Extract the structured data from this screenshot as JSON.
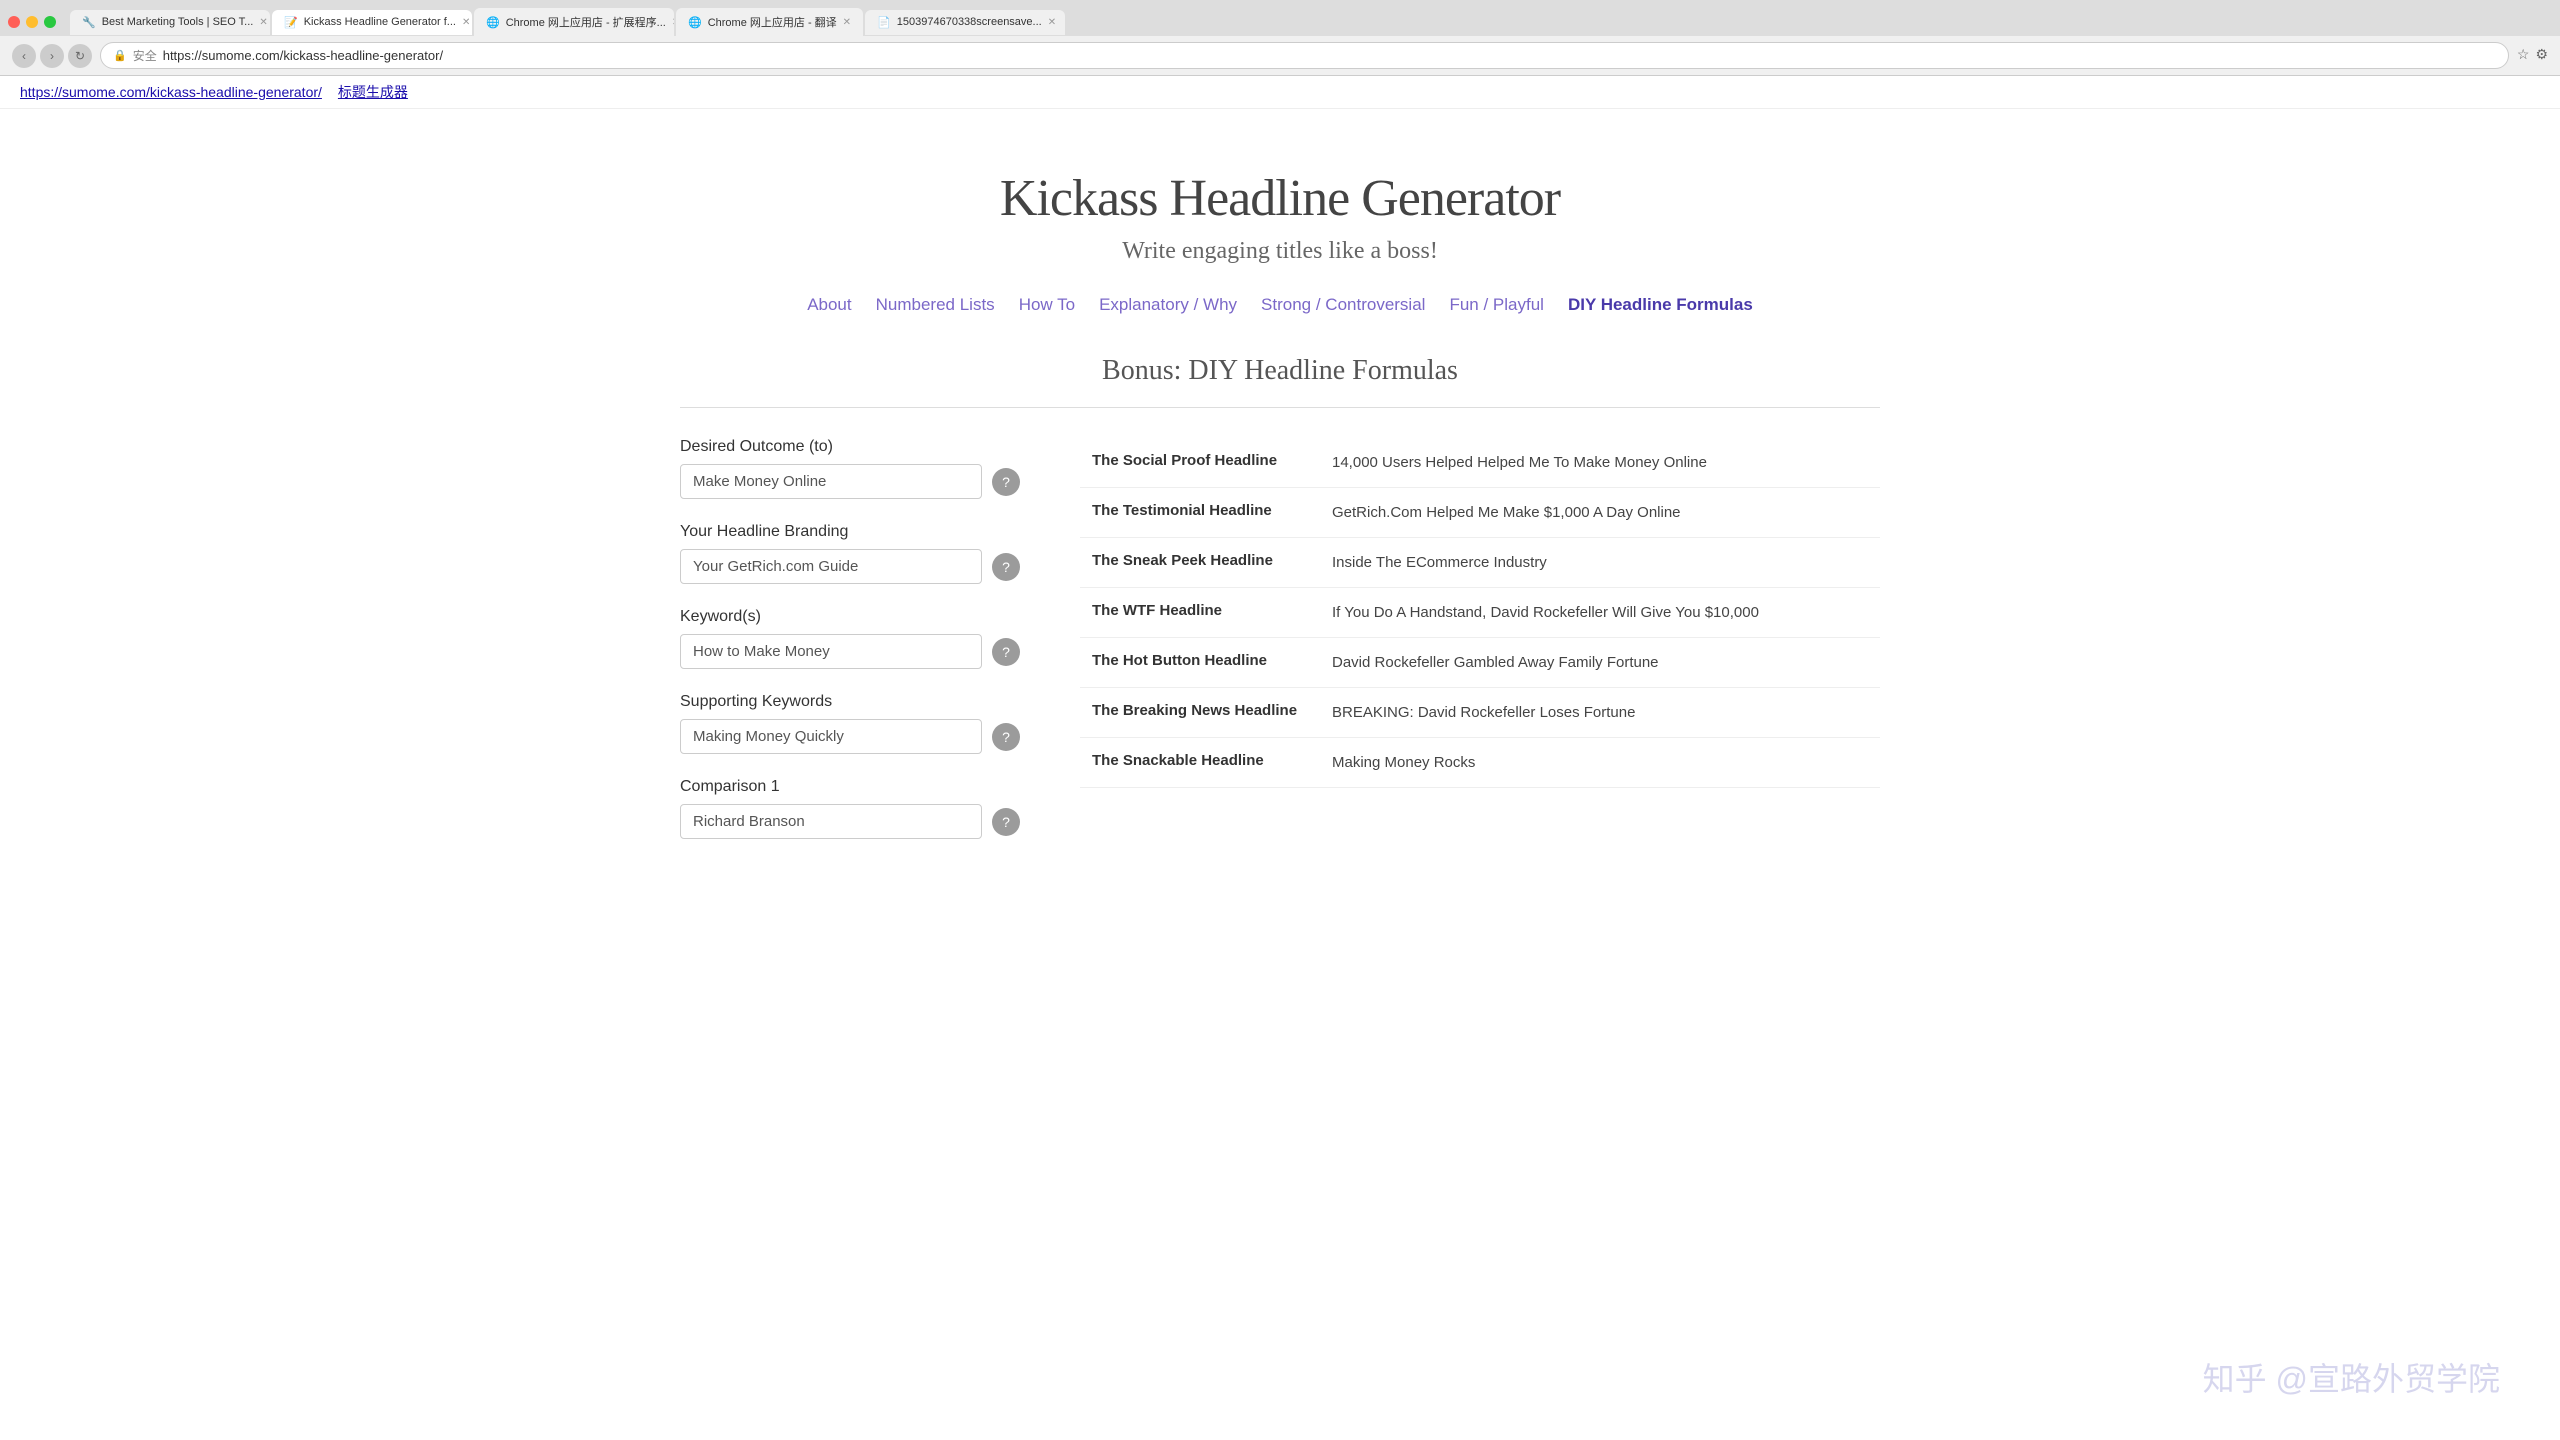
{
  "browser": {
    "tabs": [
      {
        "id": "tab1",
        "label": "Best Marketing Tools | SEO T...",
        "active": false,
        "favicon": "🔧"
      },
      {
        "id": "tab2",
        "label": "Kickass Headline Generator f...",
        "active": true,
        "favicon": "📝"
      },
      {
        "id": "tab3",
        "label": "Chrome 网上应用店 - 扩展程序...",
        "active": false,
        "favicon": "🌐"
      },
      {
        "id": "tab4",
        "label": "Chrome 网上应用店 - 翻译",
        "active": false,
        "favicon": "🌐"
      },
      {
        "id": "tab5",
        "label": "1503974670338screensave...",
        "active": false,
        "favicon": "📄"
      }
    ],
    "url": "https://sumome.com/kickass-headline-generator/",
    "security_label": "安全"
  },
  "translation_bar": {
    "link_url": "https://sumome.com/kickass-headline-generator/",
    "link_text": "https://sumome.com/kickass-headline-generator/",
    "translated_text": "标题生成器"
  },
  "page": {
    "title": "Kickass Headline Generator",
    "subtitle": "Write engaging titles like a boss!",
    "section_title": "Bonus: DIY Headline Formulas"
  },
  "nav": {
    "items": [
      {
        "id": "about",
        "label": "About",
        "active": false
      },
      {
        "id": "numbered",
        "label": "Numbered Lists",
        "active": false
      },
      {
        "id": "howto",
        "label": "How To",
        "active": false
      },
      {
        "id": "explanatory",
        "label": "Explanatory / Why",
        "active": false
      },
      {
        "id": "controversial",
        "label": "Strong / Controversial",
        "active": false
      },
      {
        "id": "playful",
        "label": "Fun / Playful",
        "active": false
      },
      {
        "id": "diy",
        "label": "DIY Headline Formulas",
        "active": true
      }
    ]
  },
  "form": {
    "fields": [
      {
        "id": "desired_outcome",
        "label": "Desired Outcome (to)",
        "value": "Make Money Online",
        "placeholder": "Make Money Online",
        "has_help": true
      },
      {
        "id": "headline_branding",
        "label": "Your Headline Branding",
        "value": "Your GetRich.com Guide",
        "placeholder": "Your GetRich.com Guide",
        "has_help": true
      },
      {
        "id": "keywords",
        "label": "Keyword(s)",
        "value": "How to Make Money",
        "placeholder": "How to Make Money",
        "has_help": true
      },
      {
        "id": "supporting_keywords",
        "label": "Supporting Keywords",
        "value": "Making Money Quickly",
        "placeholder": "Making Money Quickly",
        "has_help": true
      },
      {
        "id": "comparison1",
        "label": "Comparison 1",
        "value": "Richard Branson",
        "placeholder": "Richard Branson",
        "has_help": true
      }
    ]
  },
  "results": {
    "rows": [
      {
        "type": "The Social Proof Headline",
        "result": "14,000 Users Helped Helped Me To Make Money Online"
      },
      {
        "type": "The Testimonial Headline",
        "result": "GetRich.Com Helped Me Make $1,000 A Day Online"
      },
      {
        "type": "The Sneak Peek Headline",
        "result": "Inside The ECommerce Industry"
      },
      {
        "type": "The WTF Headline",
        "result": "If You Do A Handstand, David Rockefeller Will Give You $10,000"
      },
      {
        "type": "The Hot Button Headline",
        "result": "David Rockefeller Gambled Away Family Fortune"
      },
      {
        "type": "The Breaking News Headline",
        "result": "BREAKING: David Rockefeller Loses Fortune"
      },
      {
        "type": "The Snackable Headline",
        "result": "Making Money Rocks"
      }
    ]
  },
  "watermark": "知乎 @宣路外贸学院"
}
